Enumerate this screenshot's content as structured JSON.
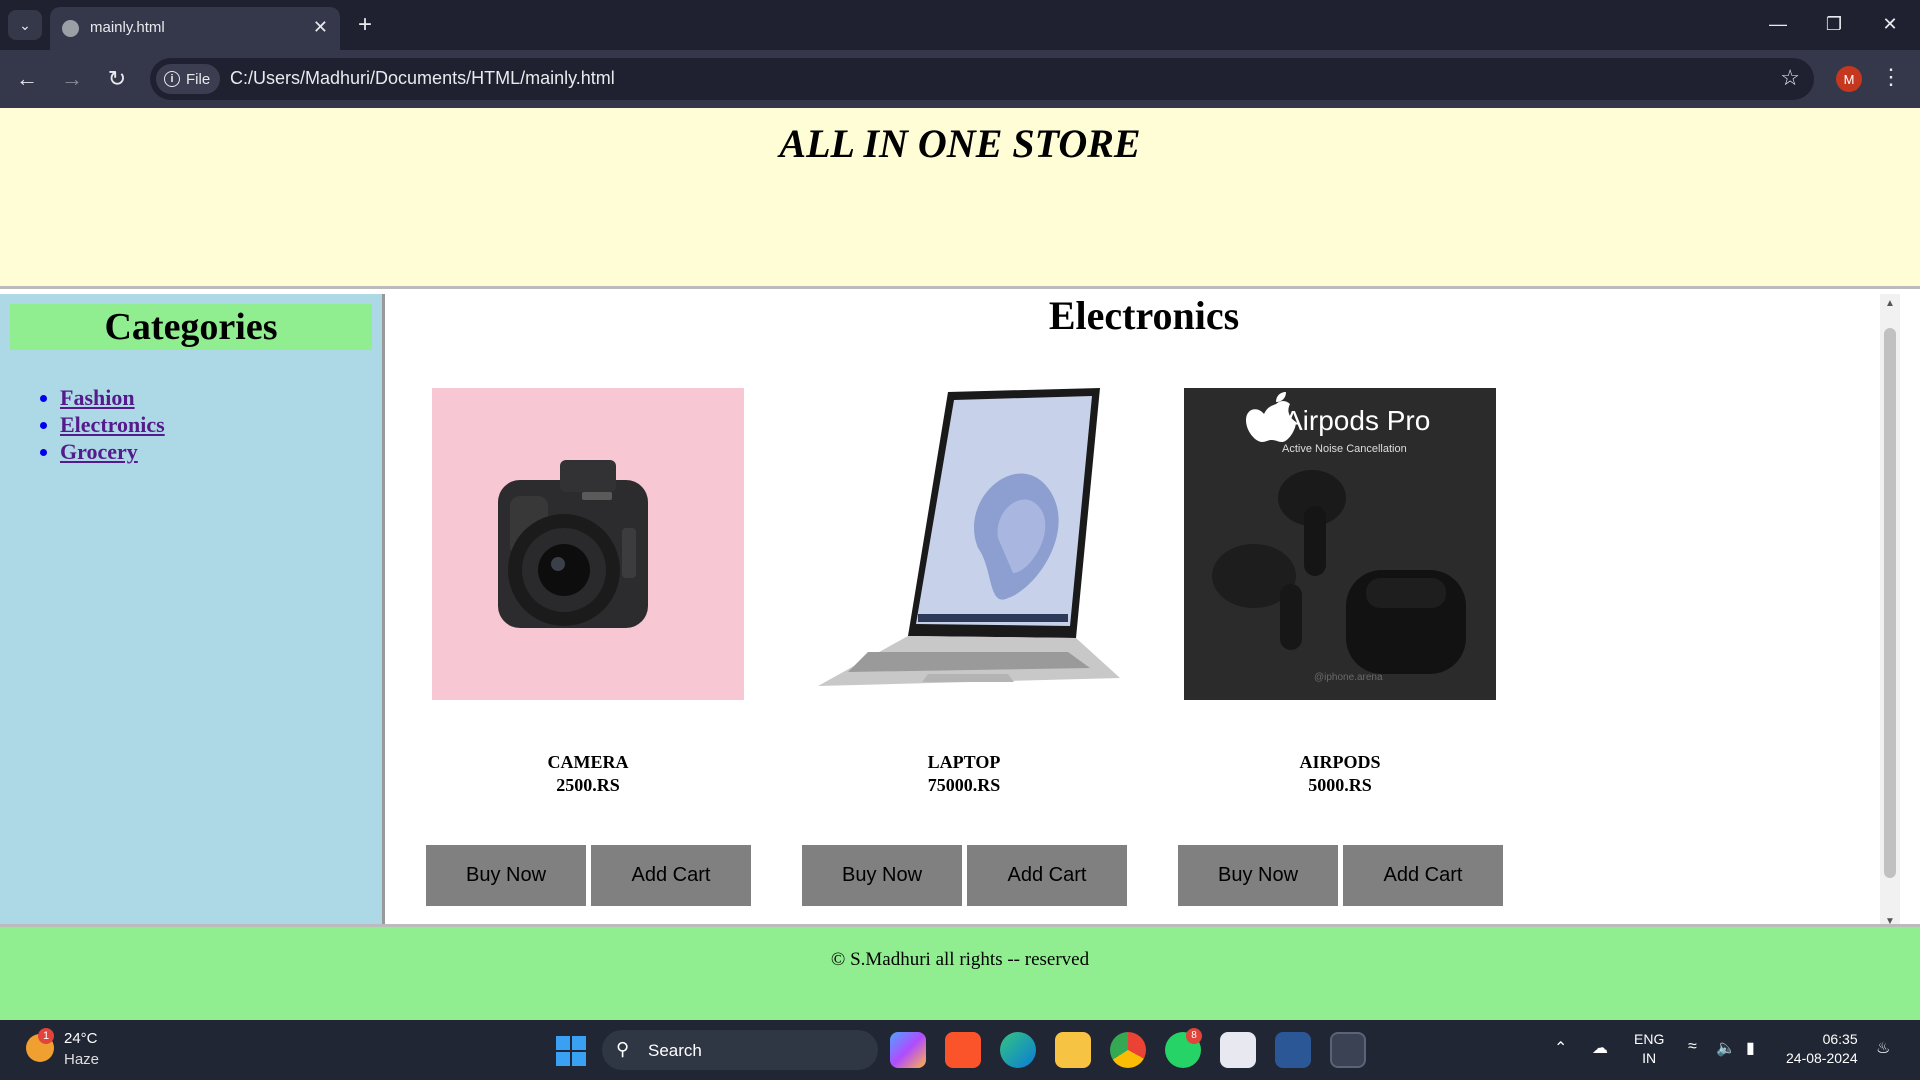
{
  "browser": {
    "tab_title": "mainly.html",
    "new_tab_label": "+",
    "url_chip_label": "File",
    "url": "C:/Users/Madhuri/Documents/HTML/mainly.html",
    "profile_initial": "M"
  },
  "page": {
    "store_title": "ALL IN ONE STORE",
    "sidebar": {
      "title": "Categories",
      "items": [
        {
          "label": "Fashion"
        },
        {
          "label": "Electronics"
        },
        {
          "label": "Grocery"
        }
      ]
    },
    "section_title": "Electronics",
    "products": [
      {
        "name": "CAMERA",
        "price": "2500.RS",
        "buy_label": "Buy Now",
        "cart_label": "Add Cart",
        "image": "camera-image"
      },
      {
        "name": "LAPTOP",
        "price": "75000.RS",
        "buy_label": "Buy Now",
        "cart_label": "Add Cart",
        "image": "laptop-image"
      },
      {
        "name": "AIRPODS",
        "price": "5000.RS",
        "buy_label": "Buy Now",
        "cart_label": "Add Cart",
        "image": "airpods-image"
      }
    ],
    "airpods_image_text": {
      "title": "Airpods Pro",
      "subtitle": "Active Noise Cancellation",
      "watermark": "@iphone.arena"
    },
    "footer": "© S.Madhuri all rights -- reserved"
  },
  "taskbar": {
    "weather_temp": "24°C",
    "weather_desc": "Haze",
    "weather_badge": "1",
    "search_label": "Search",
    "whatsapp_badge": "8",
    "lang_line1": "ENG",
    "lang_line2": "IN",
    "time": "06:35",
    "date": "24-08-2024"
  },
  "colors": {
    "header_bg": "#fffdd5",
    "sidebar_bg": "#add8e6",
    "category_title_bg": "#90ee90",
    "footer_bg": "#90ee90",
    "button_bg": "#808080"
  }
}
